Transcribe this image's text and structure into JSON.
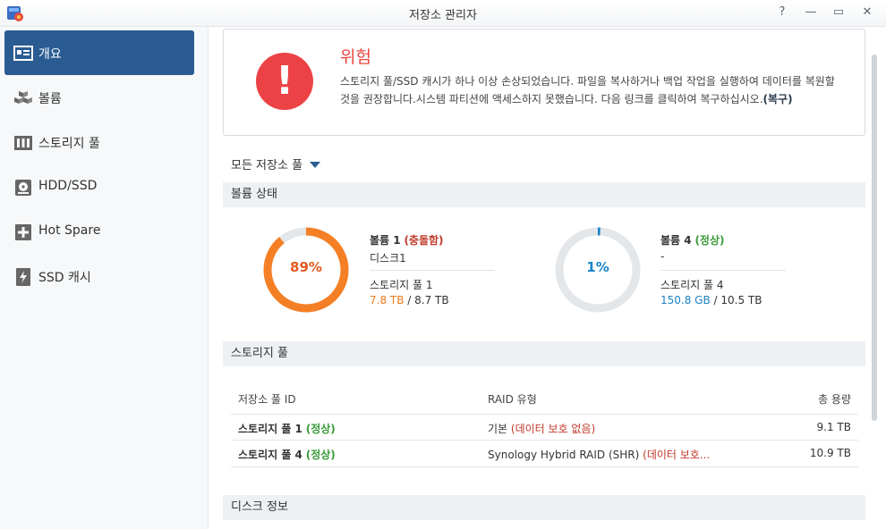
{
  "window": {
    "title": "저장소 관리자",
    "buttons": {
      "help": "?",
      "minimize": "—",
      "maximize": "▭",
      "close": "✕"
    }
  },
  "sidebar": {
    "items": [
      {
        "label": "개요",
        "icon": "overview-icon",
        "active": true
      },
      {
        "label": "볼륨",
        "icon": "volume-icon",
        "active": false
      },
      {
        "label": "스토리지 풀",
        "icon": "storage-pool-icon",
        "active": false
      },
      {
        "label": "HDD/SSD",
        "icon": "hdd-icon",
        "active": false
      },
      {
        "label": "Hot Spare",
        "icon": "hot-spare-icon",
        "active": false
      },
      {
        "label": "SSD 캐시",
        "icon": "ssd-cache-icon",
        "active": false
      }
    ]
  },
  "alert": {
    "icon": "!",
    "title": "위험",
    "message": "스토리지 풀/SSD 캐시가 하나 이상 손상되었습니다. 파일을 복사하거나 백업 작업을 실행하여 데이터를 복원할 것을 권장합니다.시스템 파티션에 액세스하지 못했습니다. 다음 링크를 클릭하여 복구하십시오.",
    "link": "(복구)"
  },
  "filter": {
    "label": "모든 저장소 풀"
  },
  "volume_status": {
    "title": "볼륨 상태",
    "volumes": [
      {
        "name": "볼륨 1",
        "status": "(충돌함)",
        "subtitle": "디스크1",
        "pool": "스토리지 풀 1",
        "used": "7.8 TB",
        "separator": " / ",
        "total": "8.7 TB",
        "percent_label": "89%",
        "percent": 89,
        "ring_color": "#f57f25"
      },
      {
        "name": "볼륨 4",
        "status": "(정상)",
        "subtitle": "-",
        "pool": "스토리지 풀 4",
        "used": "150.8 GB",
        "separator": " / ",
        "total": "10.5 TB",
        "percent_label": "1%",
        "percent": 1,
        "ring_color": "#1c83c7"
      }
    ]
  },
  "storage_pool": {
    "title": "스토리지 풀",
    "headers": {
      "id": "저장소 풀 ID",
      "raid": "RAID 유형",
      "capacity": "총 용량"
    },
    "rows": [
      {
        "name": "스토리지 풀 1",
        "status": "(정상)",
        "raid": "기본",
        "raid_note": "(데이터 보호 없음)",
        "capacity": "9.1 TB"
      },
      {
        "name": "스토리지 풀 4",
        "status": "(정상)",
        "raid": "Synology Hybrid RAID (SHR)",
        "raid_note": "(데이터 보호...",
        "capacity": "10.9 TB"
      }
    ]
  },
  "disk_info": {
    "title": "디스크 정보"
  },
  "colors": {
    "accent": "#2a5c92",
    "danger": "#ec4245",
    "ok": "#3a9b3a",
    "orange": "#f57f25",
    "blue": "#1c83c7"
  }
}
